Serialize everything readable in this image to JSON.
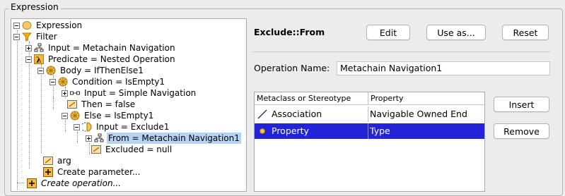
{
  "group_title": "Expression",
  "tree": [
    {
      "label": "Expression",
      "icon": "expression-icon"
    },
    {
      "label": "Filter",
      "icon": "filter-icon"
    },
    {
      "label": "Input = Metachain Navigation",
      "icon": "navigation-icon"
    },
    {
      "label": "Predicate = Nested Operation",
      "icon": "lambda-icon"
    },
    {
      "label": "Body = IfThenElse1",
      "icon": "operation-icon"
    },
    {
      "label": "Condition = IsEmpty1",
      "icon": "operation-icon"
    },
    {
      "label": "Input = Simple Navigation",
      "icon": "simple-navigation-icon"
    },
    {
      "label": "Then = false",
      "icon": "value-icon"
    },
    {
      "label": "Else = IsEmpty1",
      "icon": "operation-icon"
    },
    {
      "label": "Input = Exclude1",
      "icon": "exclude-icon"
    },
    {
      "label": "From = Metachain Navigation1",
      "icon": "navigation-icon"
    },
    {
      "label": "Excluded = null",
      "icon": "value-icon"
    },
    {
      "label": "arg",
      "icon": "value-icon"
    },
    {
      "label": "Create parameter...",
      "icon": "add-icon"
    },
    {
      "label": "Create operation...",
      "icon": "add-icon"
    }
  ],
  "detail": {
    "title": "Exclude::From",
    "edit_label": "Edit",
    "use_as_label": "Use as...",
    "reset_label": "Reset",
    "operation_name_label": "Operation Name:",
    "operation_name_value": "Metachain Navigation1"
  },
  "table": {
    "headers": [
      "Metaclass or Stereotype",
      "Property"
    ],
    "rows": [
      {
        "metaclass": "Association",
        "property": "Navigable Owned End",
        "icon": "association-icon"
      },
      {
        "metaclass": "Property",
        "property": "Type",
        "icon": "property-icon"
      }
    ],
    "insert_label": "Insert",
    "remove_label": "Remove"
  },
  "colors": {
    "selection": "#2323d7",
    "tree_selection": "#b6d3f3",
    "background": "#ececec"
  }
}
